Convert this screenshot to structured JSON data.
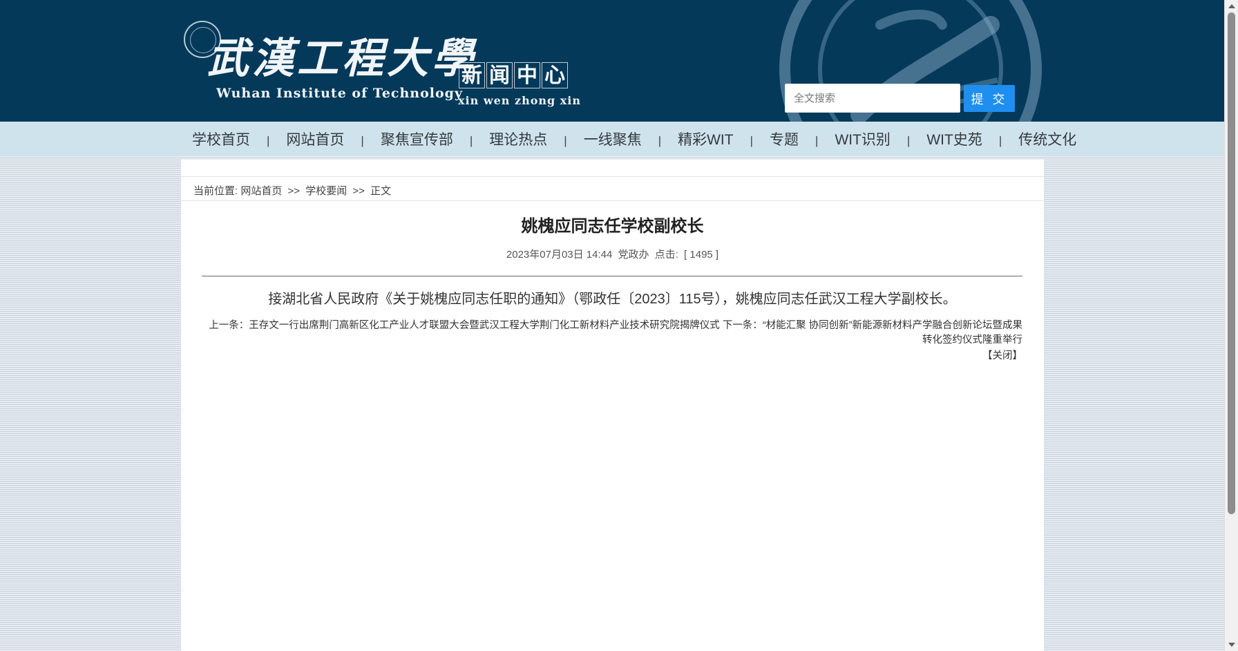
{
  "header": {
    "logo_cn": "武漢工程大學",
    "logo_en": "Wuhan Institute of Technology",
    "site_name_chars": [
      "新",
      "闻",
      "中",
      "心"
    ],
    "site_pinyin": "xin wen zhong xin",
    "search": {
      "placeholder": "全文搜索",
      "value": "",
      "button_label": "提 交"
    },
    "colors": {
      "header_bg": "#04395a",
      "nav_bg": "#cfe3ec",
      "button_bg": "#1e8ff0"
    }
  },
  "nav": {
    "items": [
      {
        "label": "学校首页"
      },
      {
        "label": "网站首页"
      },
      {
        "label": "聚焦宣传部"
      },
      {
        "label": "理论热点"
      },
      {
        "label": "一线聚焦"
      },
      {
        "label": "精彩WIT"
      },
      {
        "label": "专题"
      },
      {
        "label": "WIT识别"
      },
      {
        "label": "WIT史苑"
      },
      {
        "label": "传统文化"
      }
    ],
    "separator": "|"
  },
  "breadcrumb": {
    "prefix": "当前位置:",
    "items": [
      {
        "label": "网站首页"
      },
      {
        "label": "学校要闻"
      },
      {
        "label": "正文"
      }
    ],
    "separator": ">>"
  },
  "article": {
    "title": "姚槐应同志任学校副校长",
    "meta": {
      "datetime": "2023年07月03日 14:44",
      "source": "党政办",
      "clicks_label": "点击:",
      "clicks_value": "[ 1495 ]"
    },
    "body": "接湖北省人民政府《关于姚槐应同志任职的通知》（鄂政任〔2023〕115号），姚槐应同志任武汉工程大学副校长。",
    "prev_label": "上一条：",
    "prev_title": "王存文一行出席荆门高新区化工产业人才联盟大会暨武汉工程大学荆门化工新材料产业技术研究院揭牌仪式",
    "next_label": "下一条：",
    "next_title": "“材能汇聚 协同创新”新能源新材料产学融合创新论坛暨成果转化签约仪式隆重举行",
    "close_label": "【关闭】"
  }
}
